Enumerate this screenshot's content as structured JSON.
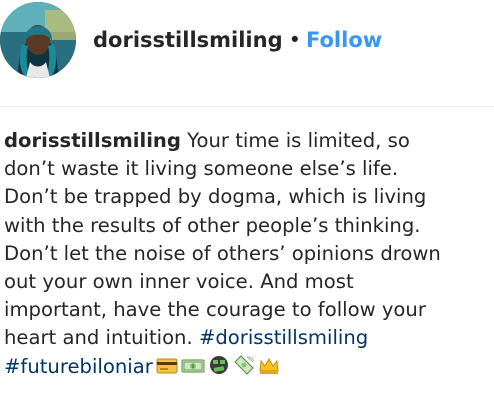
{
  "post": {
    "username": "dorisstillsmiling",
    "separator": "•",
    "follow_label": "Follow"
  },
  "caption": {
    "username": "dorisstillsmiling",
    "lines": [
      " Your time is limited, so",
      "don’t waste it living someone else’s life.",
      "Don’t be trapped by dogma, which is living",
      "with the results of other people’s thinking.",
      "Don’t let the noise of others’ opinions drown",
      "out your own inner voice. And most",
      "important, have the courage to follow your",
      "heart and intuition. "
    ],
    "hashtag_1": "#dorisstillsmiling",
    "hashtag_2": "#futurebiloniar",
    "emojis": [
      "credit-card-icon",
      "dollar-banknote-icon",
      "money-mouth-icon",
      "money-with-wings-icon",
      "crown-icon"
    ]
  },
  "colors": {
    "follow": "#3897f0",
    "hashtag": "#003569",
    "text": "#262626"
  }
}
